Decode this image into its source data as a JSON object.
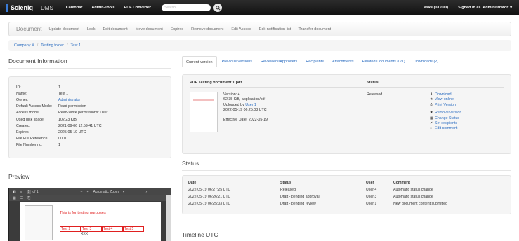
{
  "navbar": {
    "brand": "Scieniq",
    "dms": "DMS",
    "links": [
      "Calendar",
      "Admin-Tools",
      "PDF Converter"
    ],
    "search_placeholder": "Search",
    "tasks": "Tasks (0/0/0/0)",
    "signed_in": "Signed in as 'Administrator'"
  },
  "toolbar": {
    "title": "Document",
    "items": [
      "Update document",
      "Lock",
      "Edit document",
      "Move document",
      "Expires",
      "Remove document",
      "Edit Access",
      "Edit notification list",
      "Transfer document"
    ]
  },
  "breadcrumb": [
    "Company X",
    "Testing folder",
    "Test 1"
  ],
  "doc_info": {
    "title": "Document Information",
    "rows": [
      {
        "k": "ID:",
        "v": "1"
      },
      {
        "k": "Name:",
        "v": "Test 1"
      },
      {
        "k": "Owner:",
        "v": "Administrator"
      },
      {
        "k": "Default Access Mode:",
        "v": "Read permission"
      },
      {
        "k": "Access mode:",
        "v": "Read-Write permissions: User 1"
      },
      {
        "k": "Used disk space:",
        "v": "102.23 KiB"
      },
      {
        "k": "Created:",
        "v": "2021-09-06 12:59:41 UTC"
      },
      {
        "k": "Expires:",
        "v": "2025-05-19 UTC"
      },
      {
        "k": "File Full Reference:",
        "v": "0001"
      },
      {
        "k": "File Numbering:",
        "v": "1"
      }
    ]
  },
  "preview": {
    "title": "Preview",
    "page": "1",
    "of": "of 1",
    "zoom": "Automatic Zoom",
    "doc_text": "This is for testing purposes",
    "table_cells": [
      "Test 2",
      "Test 3",
      "Test 4",
      "Test 5"
    ],
    "table_cell2": "XXX"
  },
  "tabs": [
    "Current version",
    "Previous versions",
    "Reviewers/Approvers",
    "Recipients",
    "Attachments",
    "Related Documents (0/1)",
    "Downloads (2)"
  ],
  "current_version": {
    "file_name": "PDF Testing document 1.pdf",
    "status_header": "Status",
    "version": "Version: 4",
    "size": "62.35 KiB, application/pdf",
    "uploaded_label": "Uploaded by",
    "uploaded_user": "User 1",
    "uploaded_date": "2022-05-19 06:25:03 UTC",
    "effective": "Effective Date: 2022-05-19",
    "status": "Released",
    "actions": [
      "Download",
      "View online",
      "Print Version"
    ],
    "actions2": [
      "Remove version",
      "Change Status",
      "Set recipients",
      "Edit comment"
    ]
  },
  "status_section": {
    "title": "Status",
    "headers": [
      "Date",
      "Status",
      "User",
      "Comment"
    ],
    "rows": [
      {
        "date": "2022-05-19 06:27:25 UTC",
        "status": "Released",
        "user": "User 4",
        "comment": "Automatic status change"
      },
      {
        "date": "2022-05-19 06:26:21 UTC",
        "status": "Draft - pending approval",
        "user": "User 3",
        "comment": "Automatic status change"
      },
      {
        "date": "2022-05-19 06:25:03 UTC",
        "status": "Draft - pending review",
        "user": "User 1",
        "comment": "New document content submitted"
      }
    ]
  },
  "timeline_title": "Timeline UTC"
}
